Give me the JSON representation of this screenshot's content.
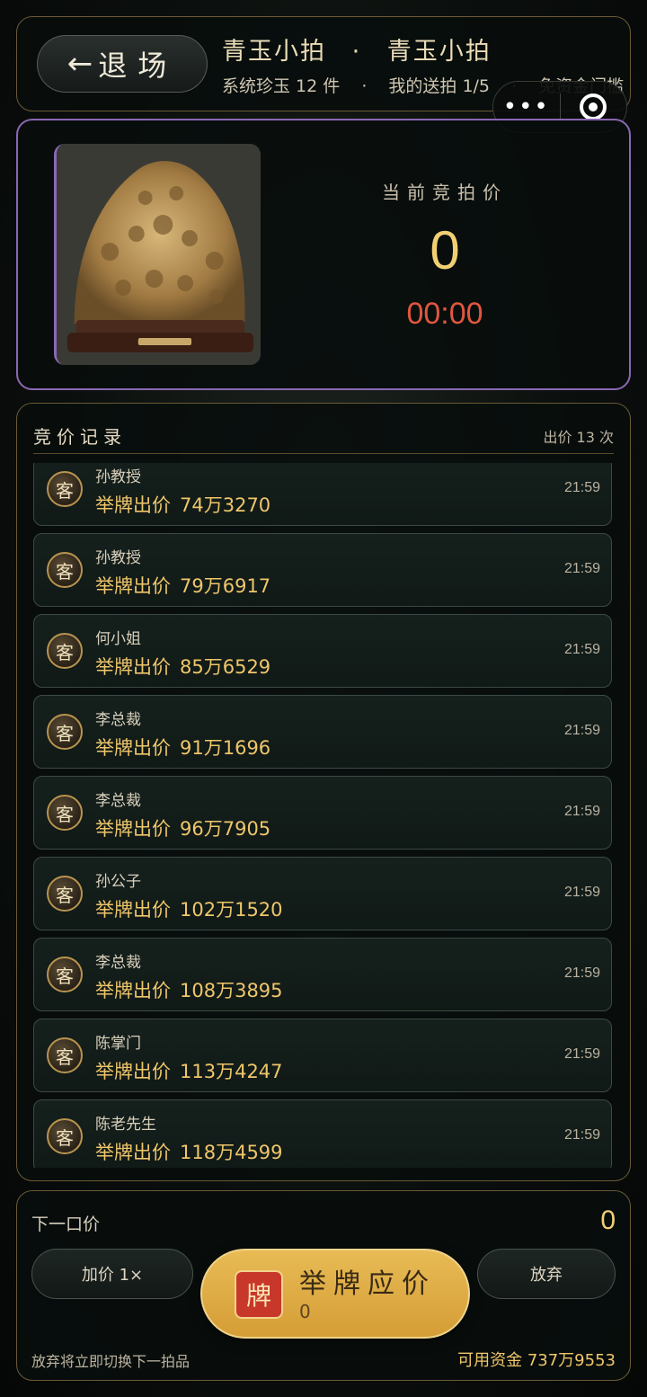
{
  "header": {
    "exit_arrow": "←",
    "exit_label": "退场",
    "title_left": "青玉小拍",
    "title_sep": "·",
    "title_right": "青玉小拍",
    "sub_system": "系统珍玉 12 件",
    "sub_sep1": "·",
    "sub_mine": "我的送拍 1/5",
    "sub_sep2": "·",
    "sub_threshold": "免资金门槛"
  },
  "capsule": {
    "more": "•••",
    "icons": [
      "more-icon",
      "target-icon"
    ]
  },
  "lot": {
    "label": "当前竞拍价",
    "price": "0",
    "timer": "00:00"
  },
  "records": {
    "title": "竞价记录",
    "count": "出价 13 次",
    "items": [
      {
        "name": "孙教授",
        "action": "举牌出价",
        "amount": "74万3270",
        "time": "21:59"
      },
      {
        "name": "孙教授",
        "action": "举牌出价",
        "amount": "79万6917",
        "time": "21:59"
      },
      {
        "name": "何小姐",
        "action": "举牌出价",
        "amount": "85万6529",
        "time": "21:59"
      },
      {
        "name": "李总裁",
        "action": "举牌出价",
        "amount": "91万1696",
        "time": "21:59"
      },
      {
        "name": "李总裁",
        "action": "举牌出价",
        "amount": "96万7905",
        "time": "21:59"
      },
      {
        "name": "孙公子",
        "action": "举牌出价",
        "amount": "102万1520",
        "time": "21:59"
      },
      {
        "name": "李总裁",
        "action": "举牌出价",
        "amount": "108万3895",
        "time": "21:59"
      },
      {
        "name": "陈掌门",
        "action": "举牌出价",
        "amount": "113万4247",
        "time": "21:59"
      },
      {
        "name": "陈老先生",
        "action": "举牌出价",
        "amount": "118万4599",
        "time": "21:59"
      }
    ],
    "avatar_char": "客"
  },
  "bottom": {
    "next_label": "下一口价",
    "next_value": "0",
    "raise_label": "加价 1×",
    "bid_badge": "牌",
    "bid_label": "举牌应价",
    "bid_sub": "0",
    "abandon_label": "放弃",
    "tip": "放弃将立即切换下一拍品",
    "funds": "可用资金 737万9553"
  },
  "colors": {
    "accent_gold": "#f2cf73",
    "timer_red": "#e0563f",
    "lot_border": "#8a68b4",
    "bid_button": "#d59d36"
  }
}
